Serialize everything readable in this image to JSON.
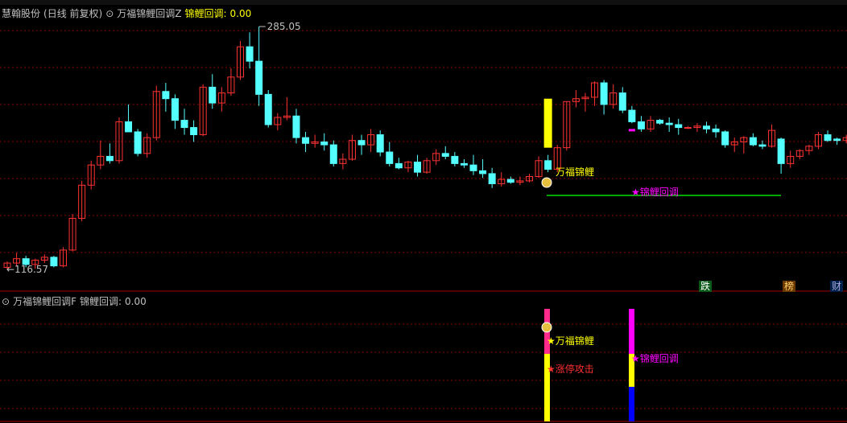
{
  "header": {
    "stock_name": "慧翰股份",
    "period": "(日线 前复权)",
    "indicator_main": "万福锦鲤回调Z",
    "signal_label": "锦鲤回调:",
    "signal_value": "0.00"
  },
  "sub_header": {
    "indicator": "万福锦鲤回调F",
    "signal_label": "锦鲤回调:",
    "signal_value": "0.00"
  },
  "price_labels": {
    "high": "285.05",
    "low": "116.57"
  },
  "annotations": {
    "main_wanfu": "万福锦鲤",
    "main_jinli": "锦鲤回调",
    "sub_wanfu": "万福锦鲤",
    "sub_zhangting": "涨停攻击",
    "sub_jinli": "锦鲤回调"
  },
  "badges": {
    "die": "跌",
    "bang": "榜",
    "cai": "财"
  },
  "colors": {
    "up": "#ff3232",
    "down": "#54ffff",
    "grid": "#8b0000",
    "yellow": "#ffff00",
    "magenta": "#ff00ff",
    "green_line": "#00e000",
    "blue": "#0000ff",
    "text": "#c0c0c0"
  },
  "candles": [
    [
      118,
      122,
      116.57,
      121
    ],
    [
      121,
      128,
      119,
      124
    ],
    [
      124,
      126,
      118,
      120
    ],
    [
      120,
      124,
      117,
      123
    ],
    [
      123,
      127,
      121,
      125
    ],
    [
      125,
      126,
      118,
      119
    ],
    [
      119,
      132,
      118,
      130
    ],
    [
      130,
      155,
      129,
      152
    ],
    [
      152,
      178,
      150,
      175
    ],
    [
      175,
      192,
      172,
      189
    ],
    [
      189,
      206,
      186,
      195
    ],
    [
      195,
      204,
      190,
      192
    ],
    [
      192,
      222,
      190,
      219
    ],
    [
      219,
      231,
      216,
      212
    ],
    [
      212,
      214,
      195,
      197
    ],
    [
      197,
      211,
      194,
      208
    ],
    [
      208,
      244,
      206,
      240
    ],
    [
      240,
      246,
      226,
      235
    ],
    [
      235,
      238,
      214,
      220
    ],
    [
      220,
      228,
      210,
      215
    ],
    [
      215,
      220,
      205,
      210
    ],
    [
      210,
      245,
      209,
      243
    ],
    [
      243,
      252,
      228,
      232
    ],
    [
      232,
      243,
      226,
      239
    ],
    [
      239,
      256,
      237,
      250
    ],
    [
      250,
      275,
      248,
      271
    ],
    [
      271,
      281,
      256,
      261
    ],
    [
      261,
      285.05,
      230,
      238
    ],
    [
      238,
      241,
      215,
      217
    ],
    [
      217,
      225,
      213,
      222
    ],
    [
      222,
      236,
      220,
      223
    ],
    [
      223,
      228,
      204,
      208
    ],
    [
      208,
      212,
      198,
      204
    ],
    [
      204,
      210,
      201,
      205
    ],
    [
      205,
      211,
      199,
      203
    ],
    [
      203,
      206,
      188,
      190
    ],
    [
      190,
      197,
      186,
      193
    ],
    [
      193,
      210,
      192,
      206
    ],
    [
      206,
      210,
      196,
      203
    ],
    [
      203,
      214,
      198,
      210
    ],
    [
      210,
      213,
      195,
      198
    ],
    [
      198,
      205,
      188,
      190
    ],
    [
      190,
      194,
      186,
      187
    ],
    [
      187,
      192,
      184,
      191
    ],
    [
      191,
      196,
      181,
      184
    ],
    [
      184,
      194,
      183,
      192
    ],
    [
      192,
      200,
      189,
      197
    ],
    [
      197,
      202,
      193,
      195
    ],
    [
      195,
      198,
      188,
      190
    ],
    [
      190,
      193,
      187,
      189
    ],
    [
      189,
      196,
      182,
      185
    ],
    [
      185,
      193,
      180,
      183
    ],
    [
      183,
      187,
      173,
      176
    ],
    [
      176,
      184,
      174,
      179
    ],
    [
      179,
      181,
      176,
      177
    ],
    [
      177,
      181,
      175,
      178
    ],
    [
      178,
      183,
      177,
      181
    ],
    [
      181,
      195,
      180,
      192
    ],
    [
      192,
      196,
      184,
      186
    ],
    [
      186,
      203,
      184,
      201
    ],
    [
      201,
      233,
      199,
      233
    ],
    [
      233,
      241,
      229,
      235
    ],
    [
      235,
      239,
      226,
      236
    ],
    [
      236,
      247,
      230,
      246
    ],
    [
      246,
      248,
      224,
      231
    ],
    [
      231,
      245,
      228,
      239
    ],
    [
      239,
      243,
      225,
      227
    ],
    [
      227,
      230,
      218,
      219
    ],
    [
      219,
      223,
      212,
      214
    ],
    [
      214,
      223,
      212,
      220
    ],
    [
      220,
      221,
      217,
      218
    ],
    [
      218,
      222,
      212,
      217
    ],
    [
      217,
      221,
      210,
      215
    ],
    [
      215,
      216,
      214,
      215
    ],
    [
      215,
      218,
      212,
      216
    ],
    [
      216,
      219,
      211,
      214
    ],
    [
      214,
      217,
      208,
      212
    ],
    [
      212,
      213,
      201,
      203
    ],
    [
      203,
      208,
      198,
      205
    ],
    [
      205,
      209,
      197,
      208
    ],
    [
      208,
      211,
      202,
      203
    ],
    [
      203,
      206,
      200,
      202
    ],
    [
      202,
      217,
      201,
      213
    ],
    [
      207,
      208,
      183,
      190
    ],
    [
      190,
      199,
      187,
      195
    ],
    [
      195,
      200,
      193,
      199
    ],
    [
      199,
      203,
      196,
      202
    ],
    [
      202,
      212,
      200,
      210
    ],
    [
      210,
      213,
      205,
      206
    ],
    [
      207,
      208,
      203,
      206
    ],
    [
      206,
      210,
      204,
      208
    ],
    [
      208,
      212,
      205,
      207
    ],
    [
      207,
      209,
      201,
      205
    ],
    [
      205,
      222,
      204,
      221
    ],
    [
      221,
      223,
      212,
      218
    ],
    [
      218,
      222,
      212,
      213
    ],
    [
      213,
      218,
      210,
      214
    ],
    [
      214,
      216,
      210,
      211
    ],
    [
      211,
      218,
      208,
      214
    ],
    [
      214,
      216,
      210,
      215
    ]
  ]
}
